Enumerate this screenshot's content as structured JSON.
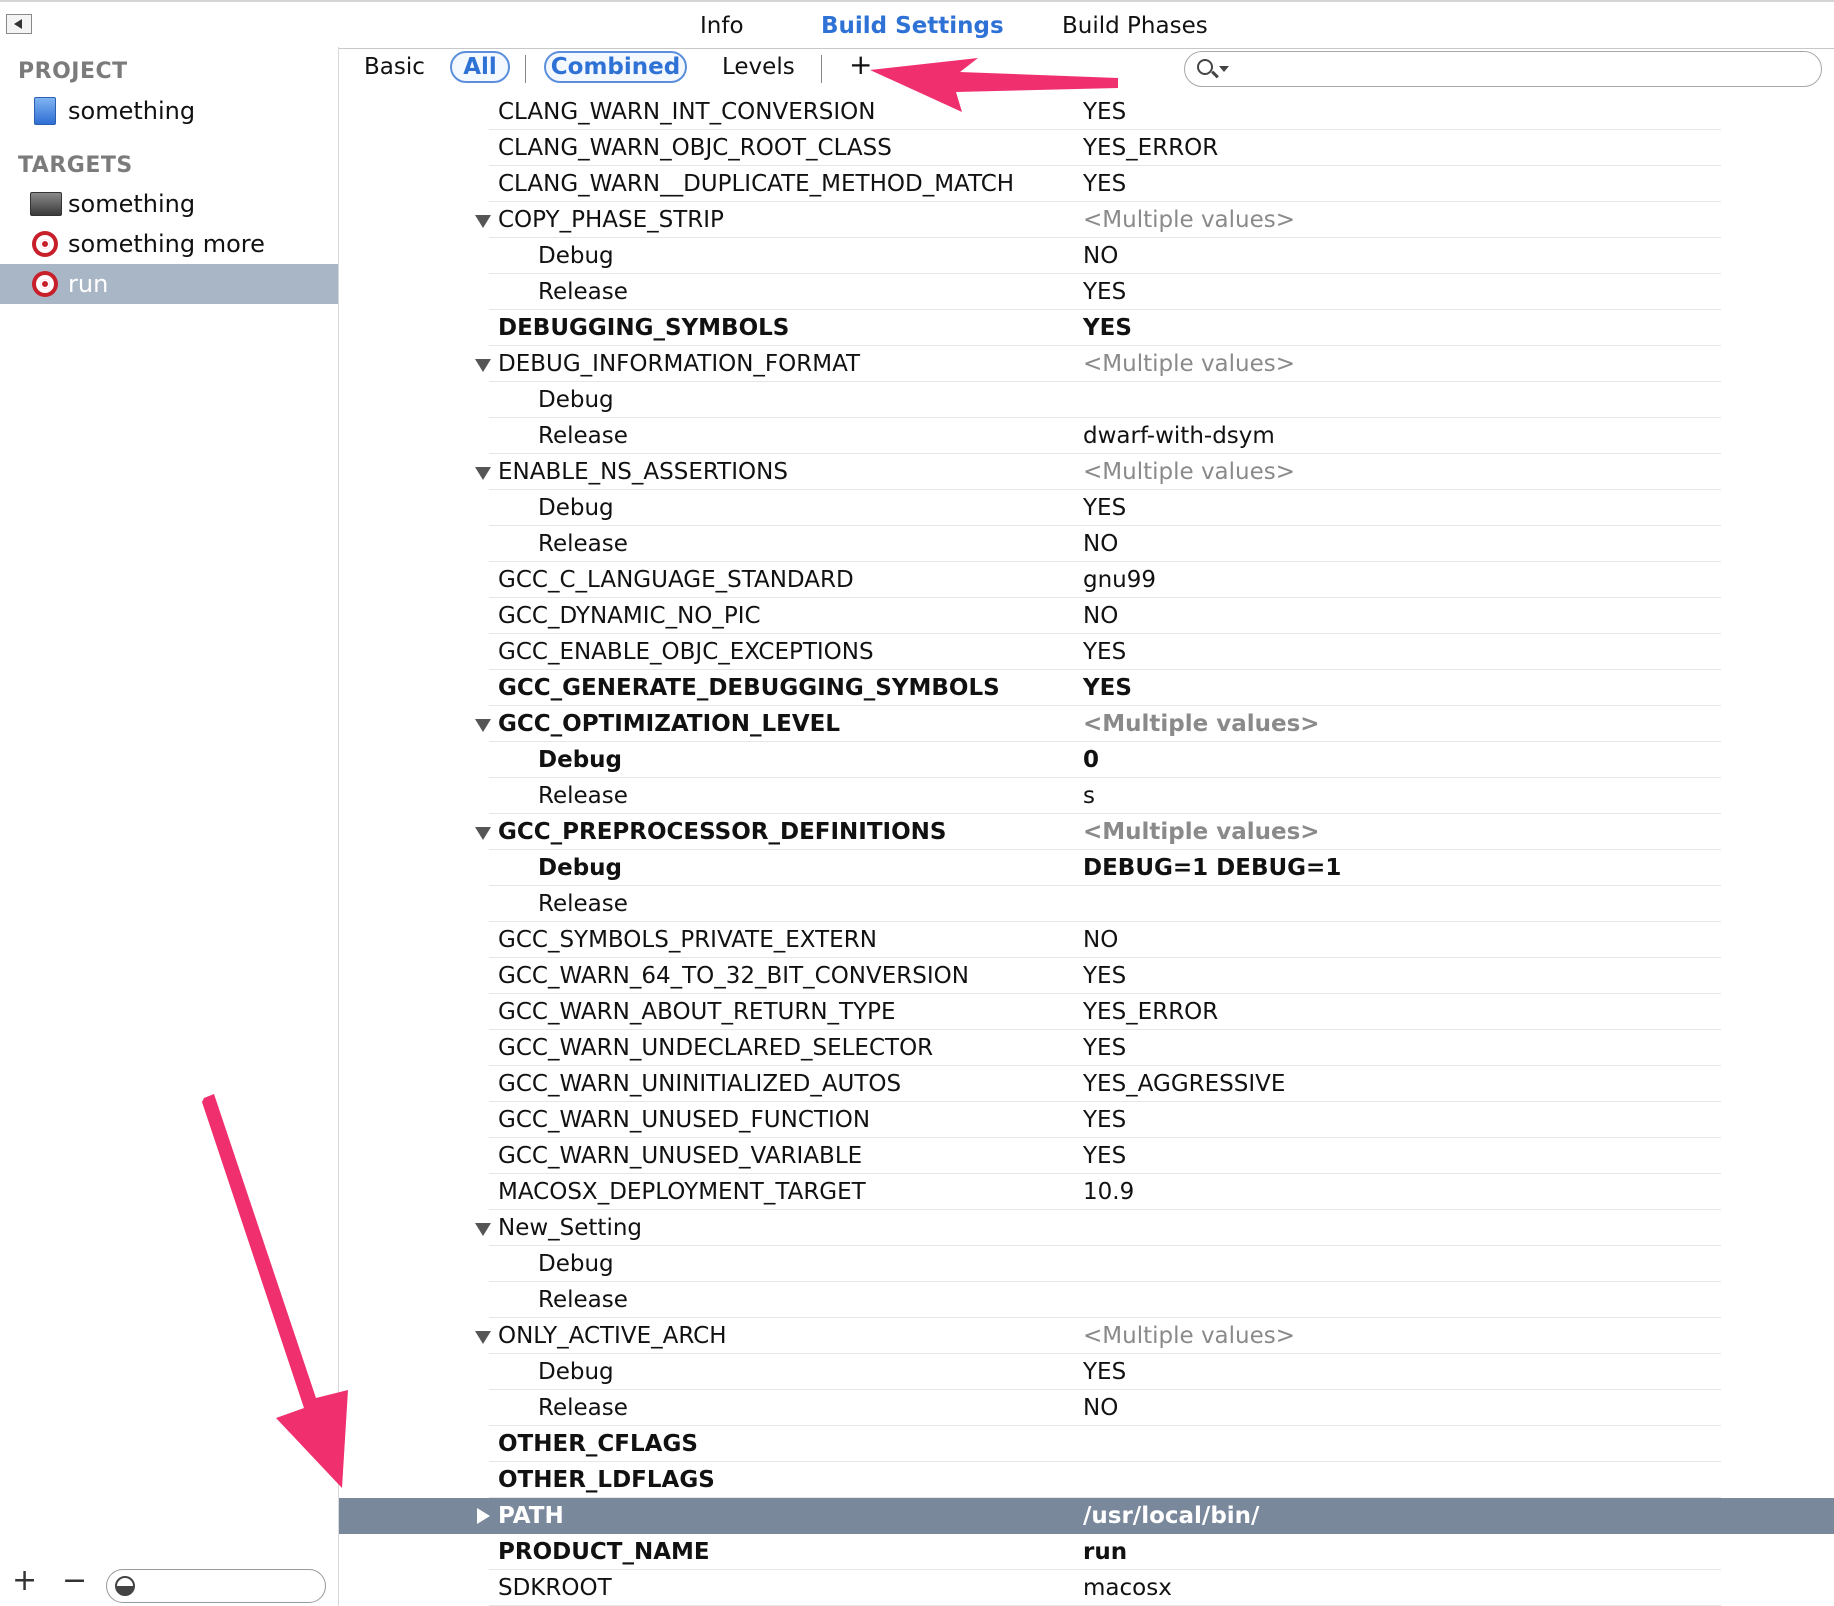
{
  "tabs": {
    "info": "Info",
    "build_settings": "Build Settings",
    "build_phases": "Build Phases"
  },
  "sidebar": {
    "project_header": "PROJECT",
    "project_item": "something",
    "targets_header": "TARGETS",
    "targets": [
      {
        "label": "something",
        "icon": "terminal-icon"
      },
      {
        "label": "something more",
        "icon": "target-icon"
      },
      {
        "label": "run",
        "icon": "target-icon",
        "selected": true
      }
    ],
    "add_label": "+",
    "remove_label": "−"
  },
  "filterbar": {
    "basic": "Basic",
    "all": "All",
    "combined": "Combined",
    "levels": "Levels",
    "add": "+"
  },
  "rows": [
    {
      "name": "CLANG_WARN_INT_CONVERSION",
      "value": "YES"
    },
    {
      "name": "CLANG_WARN_OBJC_ROOT_CLASS",
      "value": "YES_ERROR"
    },
    {
      "name": "CLANG_WARN__DUPLICATE_METHOD_MATCH",
      "value": "YES"
    },
    {
      "name": "COPY_PHASE_STRIP",
      "value": "<Multiple values>"
    },
    {
      "name": "Debug",
      "value": "NO"
    },
    {
      "name": "Release",
      "value": "YES"
    },
    {
      "name": "DEBUGGING_SYMBOLS",
      "value": "YES"
    },
    {
      "name": "DEBUG_INFORMATION_FORMAT",
      "value": "<Multiple values>"
    },
    {
      "name": "Debug",
      "value": ""
    },
    {
      "name": "Release",
      "value": "dwarf-with-dsym"
    },
    {
      "name": "ENABLE_NS_ASSERTIONS",
      "value": "<Multiple values>"
    },
    {
      "name": "Debug",
      "value": "YES"
    },
    {
      "name": "Release",
      "value": "NO"
    },
    {
      "name": "GCC_C_LANGUAGE_STANDARD",
      "value": "gnu99"
    },
    {
      "name": "GCC_DYNAMIC_NO_PIC",
      "value": "NO"
    },
    {
      "name": "GCC_ENABLE_OBJC_EXCEPTIONS",
      "value": "YES"
    },
    {
      "name": "GCC_GENERATE_DEBUGGING_SYMBOLS",
      "value": "YES"
    },
    {
      "name": "GCC_OPTIMIZATION_LEVEL",
      "value": "<Multiple values>"
    },
    {
      "name": "Debug",
      "value": "0"
    },
    {
      "name": "Release",
      "value": "s"
    },
    {
      "name": "GCC_PREPROCESSOR_DEFINITIONS",
      "value": "<Multiple values>"
    },
    {
      "name": "Debug",
      "value": "DEBUG=1 DEBUG=1"
    },
    {
      "name": "Release",
      "value": ""
    },
    {
      "name": "GCC_SYMBOLS_PRIVATE_EXTERN",
      "value": "NO"
    },
    {
      "name": "GCC_WARN_64_TO_32_BIT_CONVERSION",
      "value": "YES"
    },
    {
      "name": "GCC_WARN_ABOUT_RETURN_TYPE",
      "value": "YES_ERROR"
    },
    {
      "name": "GCC_WARN_UNDECLARED_SELECTOR",
      "value": "YES"
    },
    {
      "name": "GCC_WARN_UNINITIALIZED_AUTOS",
      "value": "YES_AGGRESSIVE"
    },
    {
      "name": "GCC_WARN_UNUSED_FUNCTION",
      "value": "YES"
    },
    {
      "name": "GCC_WARN_UNUSED_VARIABLE",
      "value": "YES"
    },
    {
      "name": "MACOSX_DEPLOYMENT_TARGET",
      "value": "10.9"
    },
    {
      "name": "New_Setting",
      "value": ""
    },
    {
      "name": "Debug",
      "value": ""
    },
    {
      "name": "Release",
      "value": ""
    },
    {
      "name": "ONLY_ACTIVE_ARCH",
      "value": "<Multiple values>"
    },
    {
      "name": "Debug",
      "value": "YES"
    },
    {
      "name": "Release",
      "value": "NO"
    },
    {
      "name": "OTHER_CFLAGS",
      "value": ""
    },
    {
      "name": "OTHER_LDFLAGS",
      "value": ""
    },
    {
      "name": "PATH",
      "value": "/usr/local/bin/"
    },
    {
      "name": "PRODUCT_NAME",
      "value": "run"
    },
    {
      "name": "SDKROOT",
      "value": "macosx"
    }
  ],
  "colors": {
    "accent": "#2f72d6",
    "selection_row": "#7a889c",
    "annotation_arrow": "#f0306e"
  }
}
